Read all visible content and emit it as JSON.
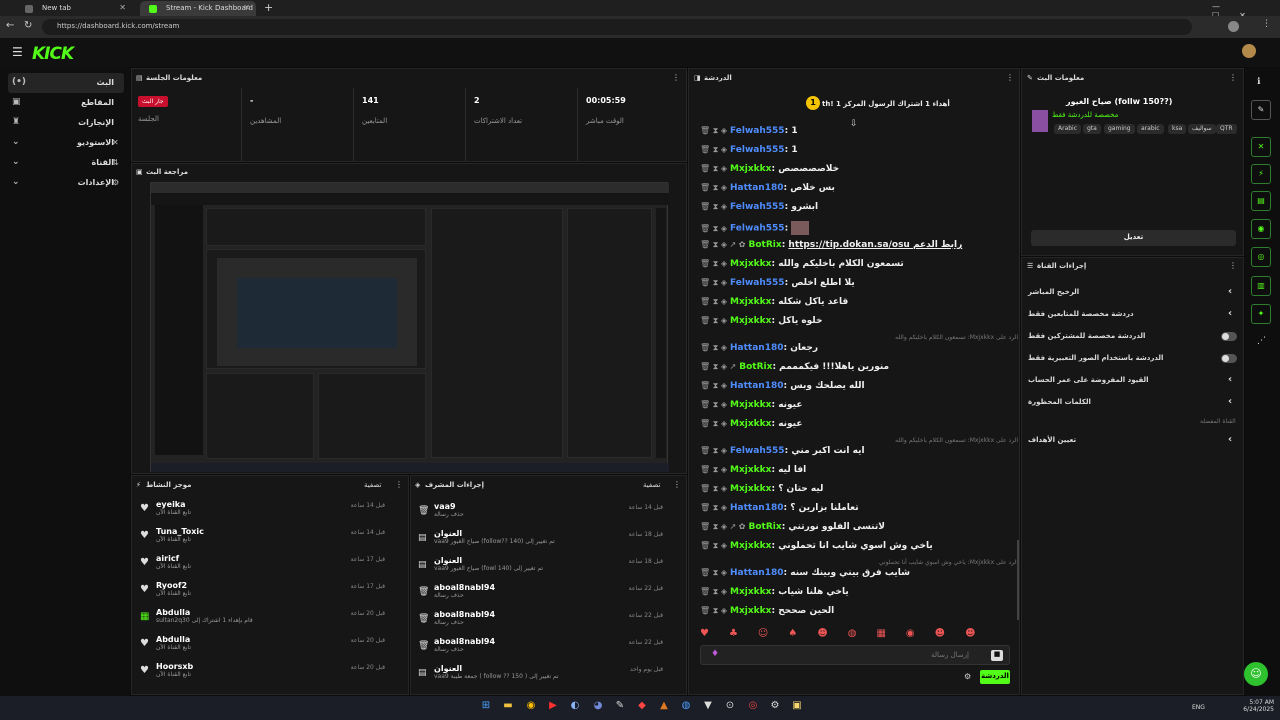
{
  "browser": {
    "tabs": [
      {
        "label": "New tab"
      },
      {
        "label": "Stream - Kick Dashboard"
      }
    ],
    "url": "https://dashboard.kick.com/stream"
  },
  "header": {
    "logo": "KICK"
  },
  "sidebar": {
    "items": [
      {
        "label": "البث"
      },
      {
        "label": "المقاطع"
      },
      {
        "label": "الإنجازات"
      },
      {
        "label": "الاستوديو"
      },
      {
        "label": "القناة"
      },
      {
        "label": "الإعدادات"
      }
    ]
  },
  "session": {
    "title": "معلومات الجلسة",
    "live_badge": "جار البث",
    "session_label": "الجلسة",
    "viewers_value": "-",
    "viewers_label": "المشاهدين",
    "followers_value": "141",
    "followers_label": "المتابعين",
    "subs_value": "2",
    "subs_label": "تعداد الاشتراكات",
    "time_value": "00:05:59",
    "time_label": "الوقت مباشر"
  },
  "preview": {
    "title": "مراجعة البث"
  },
  "activity": {
    "title": "موجز النشاط",
    "filter": "تصفية",
    "items": [
      {
        "name": "eyeika",
        "sub": "تابع القناة الآن",
        "time": "قبل 14 ساعة"
      },
      {
        "name": "Tuna_Toxic",
        "sub": "تابع القناة الآن",
        "time": "قبل 14 ساعة"
      },
      {
        "name": "airicf",
        "sub": "تابع القناة الآن",
        "time": "قبل 17 ساعة"
      },
      {
        "name": "Ryoof2",
        "sub": "تابع القناة الآن",
        "time": "قبل 17 ساعة"
      },
      {
        "name": "Abdulla",
        "sub": "sultan2q30 قام بإهداء 1 اشتراك إلى",
        "time": "قبل 20 ساعة"
      },
      {
        "name": "Abdulla",
        "sub": "تابع القناة الآن",
        "time": "قبل 20 ساعة"
      },
      {
        "name": "Hoorsxb",
        "sub": "تابع القناة الآن",
        "time": "قبل 20 ساعة"
      }
    ]
  },
  "modactions": {
    "title": "إجراءات المشرف",
    "filter": "تصفية",
    "items": [
      {
        "name": "vaa9",
        "sub": "حذف رسالة",
        "time": "قبل 14 ساعة"
      },
      {
        "name": "العنوان",
        "sub": "vaa9 صياح الغيور (follow?? 140) تم تغيير إلى",
        "time": "قبل 18 ساعة"
      },
      {
        "name": "العنوان",
        "sub": "vaa9 صياح الغيور (fowl 140) تم تغيير إلى",
        "time": "قبل 18 ساعة"
      },
      {
        "name": "aboal8nabl94",
        "sub": "حذف رسالة",
        "time": "قبل 22 ساعة"
      },
      {
        "name": "aboal8nabl94",
        "sub": "حذف رسالة",
        "time": "قبل 22 ساعة"
      },
      {
        "name": "aboal8nabl94",
        "sub": "حذف رسالة",
        "time": "قبل 22 ساعة"
      },
      {
        "name": "العنوان",
        "sub": "vaa9 جمعة طيبة ( follow ?? 150 ) تم تغيير إلى",
        "time": "قبل يوم واحد"
      }
    ]
  },
  "chat": {
    "title": "الدردشة",
    "pinned": "أهداء 1 اشتراك الرسول المركز 1 !th",
    "input_placeholder": "إرسال رسالة",
    "send_label": "الدردشة",
    "lines": [
      {
        "user": "Felwah555",
        "color": "#4f8dff",
        "msg": "1"
      },
      {
        "user": "Felwah555",
        "color": "#4f8dff",
        "msg": "1"
      },
      {
        "user": "Mxjxkkx",
        "color": "#53fc18",
        "msg": "خلاصصصصص"
      },
      {
        "user": "Hattan180",
        "color": "#4f8dff",
        "msg": "بس خلاص"
      },
      {
        "user": "Felwah555",
        "color": "#4f8dff",
        "msg": "ابشرو"
      },
      {
        "user": "Felwah555",
        "color": "#4f8dff",
        "msg": ""
      },
      {
        "user": "BotRix",
        "color": "#53fc18",
        "msg": "https://tip.dokan.sa/osu رابط الدعم"
      },
      {
        "user": "Mxjxkkx",
        "color": "#53fc18",
        "msg": "تسمعون الكلام باخليكم والله"
      },
      {
        "user": "Felwah555",
        "color": "#4f8dff",
        "msg": "يلا اطلع اخلص"
      },
      {
        "user": "Mxjxkkx",
        "color": "#53fc18",
        "msg": "قاعد ياكل شكله"
      },
      {
        "user": "Mxjxkkx",
        "color": "#53fc18",
        "msg": "خلوه ياكل"
      },
      {
        "user": "Hattan180",
        "color": "#4f8dff",
        "msg": "رجعان"
      },
      {
        "user": "BotRix",
        "color": "#53fc18",
        "msg": "منورين ياهلا!!! فيكمممم"
      },
      {
        "user": "Hattan180",
        "color": "#4f8dff",
        "msg": "الله يصلحك وبس"
      },
      {
        "user": "Mxjxkkx",
        "color": "#53fc18",
        "msg": "عيونه"
      },
      {
        "user": "Mxjxkkx",
        "color": "#53fc18",
        "msg": "عيونه"
      },
      {
        "user": "Felwah555",
        "color": "#4f8dff",
        "msg": "ايه انت اكبر مني"
      },
      {
        "user": "Mxjxkkx",
        "color": "#53fc18",
        "msg": "افا ليه"
      },
      {
        "user": "Mxjxkkx",
        "color": "#53fc18",
        "msg": "ليه حتان ؟"
      },
      {
        "user": "Hattan180",
        "color": "#4f8dff",
        "msg": "تعاملنا بزارين ؟"
      },
      {
        "user": "BotRix",
        "color": "#53fc18",
        "msg": "لاتنسى الفلوو نورتني"
      },
      {
        "user": "Mxjxkkx",
        "color": "#53fc18",
        "msg": "ياخي وش اسوي شايب أنا تحملوني"
      },
      {
        "user": "Hattan180",
        "color": "#4f8dff",
        "msg": "شايب فرق بيني وبينك سنه"
      },
      {
        "user": "Mxjxkkx",
        "color": "#53fc18",
        "msg": "ياخي هلنا شياب"
      },
      {
        "user": "Mxjxkkx",
        "color": "#53fc18",
        "msg": "الحين صححح"
      }
    ],
    "replies": [
      "الرد على Mxjxkkx: تسمعون الكلام باخليكم والله",
      "الرد على Mxjxkkx: تسمعون الكلام باخليكم والله",
      "الرد على Mxjxkkx: ياخي وش اسوي شايب أنا تحملوني"
    ]
  },
  "streaminfo": {
    "title": "معلومات البث",
    "stream_title": "صياح الغيور (follw 150??)",
    "category": "مخصصة للدردشة فقط",
    "tags": [
      "Arabic",
      "gta",
      "gaming",
      "arabic",
      "ksa",
      "سواليف",
      "QTR"
    ],
    "edit_label": "تعديل"
  },
  "channel_actions": {
    "title": "إجراءات القناة",
    "rows": [
      {
        "label": "الرخيح المباشر"
      },
      {
        "label": "دردشة مخصصة للمتابعين فقط"
      },
      {
        "label": "الدردشة مخصصة للمشتركين فقط"
      },
      {
        "label": "الدردشة باستخدام الصور التعبيرية فقط"
      },
      {
        "label": "القيود المفروضة على عمر الحساب"
      },
      {
        "label": "الكلمات المحظورة"
      }
    ],
    "section_label": "القناة المفضلة",
    "goals_label": "تعيين الأهداف"
  },
  "taskbar": {
    "lang": "ENG",
    "time": "5:07 AM",
    "date": "6/24/2025"
  }
}
